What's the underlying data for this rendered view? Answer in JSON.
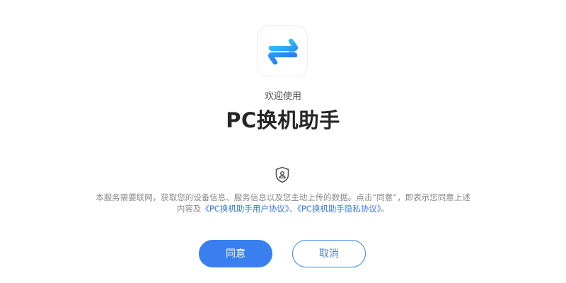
{
  "app": {
    "welcome_text": "欢迎使用",
    "title": "PC换机助手",
    "icon": "swap-arrows-icon"
  },
  "notice": {
    "icon": "privacy-shield-icon",
    "line1": "本服务需要联网，获取您的设备信息、服务信息以及您主动上传的数据。点击“同意”，即表示您同意上述",
    "line2_prefix": "内容及",
    "user_agreement_link": "《PC换机助手用户协议》",
    "separator": "、",
    "privacy_agreement_link": "《PC换机助手隐私协议》",
    "line2_suffix": "。"
  },
  "buttons": {
    "agree_label": "同意",
    "cancel_label": "取消"
  },
  "colors": {
    "accent": "#3a7ff0",
    "link": "#3377e8",
    "title_text": "#262626",
    "notice_text": "#8a8a8a"
  }
}
